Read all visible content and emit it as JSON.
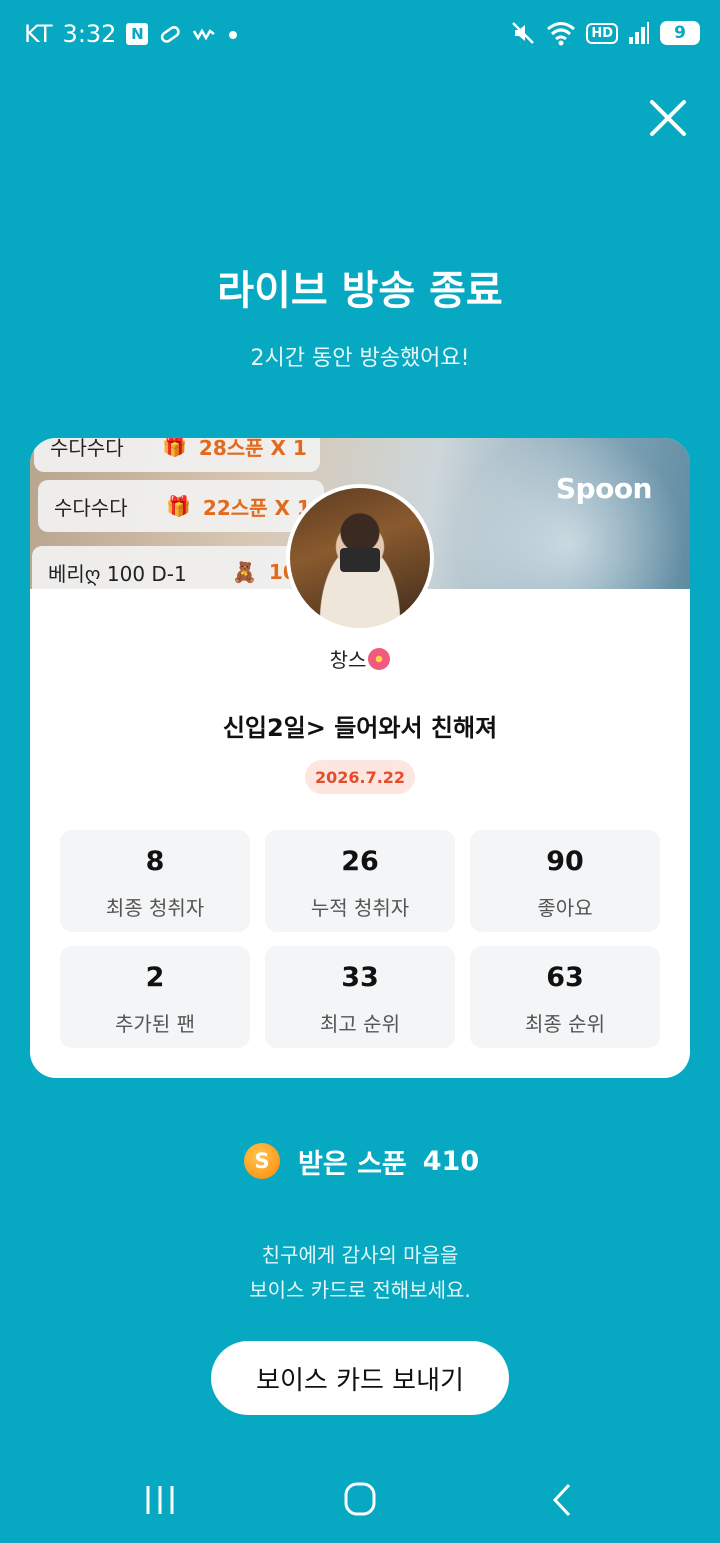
{
  "status_bar": {
    "carrier": "KT",
    "time": "3:32",
    "notification_badge": "N",
    "hd_label": "HD",
    "battery": "9"
  },
  "page": {
    "title": "라이브 방송 종료",
    "subtitle": "2시간 동안 방송했어요!"
  },
  "card": {
    "banner": {
      "brand": "Spoon",
      "chat_messages": [
        {
          "nickname": "수다수다",
          "gift": "28스푼 X 1"
        },
        {
          "nickname": "수다수다",
          "gift": "22스푼 X 1"
        },
        {
          "nickname": "베리ღ 100 D-1",
          "gift": "10"
        }
      ]
    },
    "host_name": "창스",
    "live_title": "신입2일> 들어와서 친해져",
    "date": "2026.7.22",
    "stats": [
      {
        "value": "8",
        "label": "최종 청취자"
      },
      {
        "value": "26",
        "label": "누적 청취자"
      },
      {
        "value": "90",
        "label": "좋아요"
      },
      {
        "value": "2",
        "label": "추가된 팬"
      },
      {
        "value": "33",
        "label": "최고 순위"
      },
      {
        "value": "63",
        "label": "최종 순위"
      }
    ]
  },
  "received_spoons": {
    "coin_symbol": "S",
    "label": "받은 스푼",
    "count": "410"
  },
  "message": {
    "line1": "친구에게 감사의 마음을",
    "line2": "보이스 카드로 전해보세요."
  },
  "voice_card_button": "보이스 카드 보내기",
  "colors": {
    "background": "#07a9c2",
    "card": "#ffffff",
    "date_badge_bg": "#fde6df",
    "date_badge_text": "#e64b2a",
    "gift_text": "#e26a1d",
    "coin": "#ff9a1c"
  },
  "icons": {
    "close": "close-icon",
    "coin": "spoon-coin-icon",
    "nav_recent": "recent-apps-icon",
    "nav_home": "home-icon",
    "nav_back": "back-icon"
  }
}
